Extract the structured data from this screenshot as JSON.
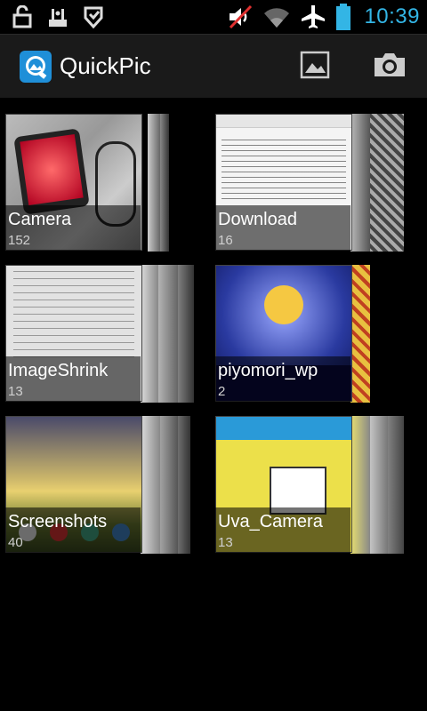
{
  "status_bar": {
    "time": "10:39",
    "icons": [
      "unlock-icon",
      "wifi-tether-icon",
      "shield-icon",
      "mute-volume-icon",
      "wifi-icon",
      "airplane-icon",
      "battery-icon"
    ],
    "accent": "#33b5e5"
  },
  "action_bar": {
    "title": "QuickPic",
    "actions": [
      "gallery-icon",
      "camera-icon"
    ]
  },
  "folders": [
    {
      "name": "Camera",
      "count": "152"
    },
    {
      "name": "Download",
      "count": "16"
    },
    {
      "name": "ImageShrink",
      "count": "13"
    },
    {
      "name": "piyomori_wp",
      "count": "2"
    },
    {
      "name": "Screenshots",
      "count": "40"
    },
    {
      "name": "Uva_Camera",
      "count": "13"
    }
  ]
}
